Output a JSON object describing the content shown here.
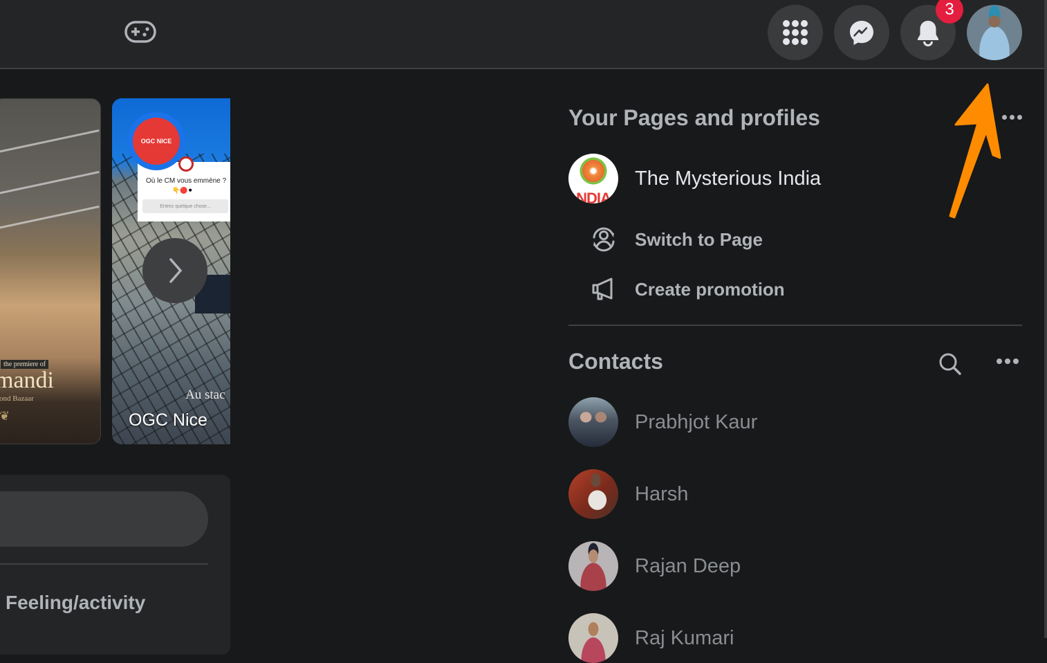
{
  "topbar": {
    "icons": {
      "gaming": "gamepad-icon",
      "menu": "grid-menu-icon",
      "messenger": "messenger-icon",
      "notifications": "bell-icon",
      "profile": "profile-avatar"
    },
    "notification_count": "3"
  },
  "stories": [
    {
      "caption_tag": "the premiere of",
      "caption_title": "mandi",
      "caption_sub": "ond Bazaar"
    },
    {
      "name": "OGC Nice",
      "logo_text": "OGC NICE",
      "card_question": "Où le CM vous emmène ?",
      "card_emoji": "👇🔴⚫",
      "card_placeholder": "Entrez quelque chose...",
      "overlay_text": "Au stac"
    }
  ],
  "composer": {
    "feeling_label": "Feeling/activity"
  },
  "pages": {
    "title": "Your Pages and profiles",
    "page_name": "The Mysterious India",
    "page_avatar_text": "NDIA",
    "actions": [
      {
        "label": "Switch to Page",
        "icon": "switch-profile-icon"
      },
      {
        "label": "Create promotion",
        "icon": "megaphone-icon"
      }
    ]
  },
  "contacts": {
    "title": "Contacts",
    "list": [
      {
        "name": "Prabhjot Kaur"
      },
      {
        "name": "Harsh"
      },
      {
        "name": "Rajan Deep"
      },
      {
        "name": "Raj Kumari"
      }
    ]
  },
  "colors": {
    "background": "#18191a",
    "surface": "#242526",
    "button": "#3a3b3c",
    "badge": "#e41e3f",
    "annotation_arrow": "#ff8c00",
    "text_primary": "#e4e6eb",
    "text_secondary": "#b0b3b8"
  }
}
